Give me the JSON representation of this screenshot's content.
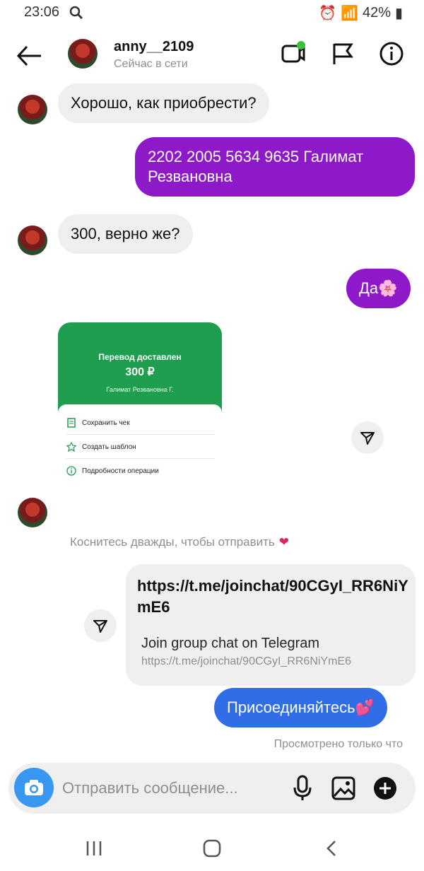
{
  "status": {
    "time": "23:06",
    "battery": "42%"
  },
  "header": {
    "username": "anny__2109",
    "presence": "Сейчас в сети"
  },
  "messages": {
    "m1": "Хорошо, как приобрести?",
    "m2": "2202 2005 5634 9635 Галимат Резвановна",
    "m3": "300, верно же?",
    "m4": "Да",
    "m4_emoji": "🌸",
    "receipt": {
      "title": "Перевод доставлен",
      "amount": "300 ₽",
      "name": "Галимат Резвановна Г.",
      "row1": "Сохранить чек",
      "row2": "Создать шаблон",
      "row3": "Подробности операции"
    },
    "hint": "Коснитесь дважды, чтобы отправить",
    "hint_heart": "❤",
    "link": {
      "title": "https://t.me/joinchat/90CGyI_RR6NiYmE6",
      "subtitle": "Join group chat on Telegram",
      "url": "https://t.me/joinchat/90CGyI_RR6NiYmE6"
    },
    "m5": "Присоединяйтесь",
    "m5_emoji": "💕",
    "seen": "Просмотрено только что"
  },
  "composer": {
    "placeholder": "Отправить сообщение..."
  },
  "colors": {
    "outgoing": "#8e19c9",
    "incoming": "#efefef",
    "blue": "#2f6ee6",
    "camera": "#3897f0",
    "receipt": "#1f9e4f"
  }
}
